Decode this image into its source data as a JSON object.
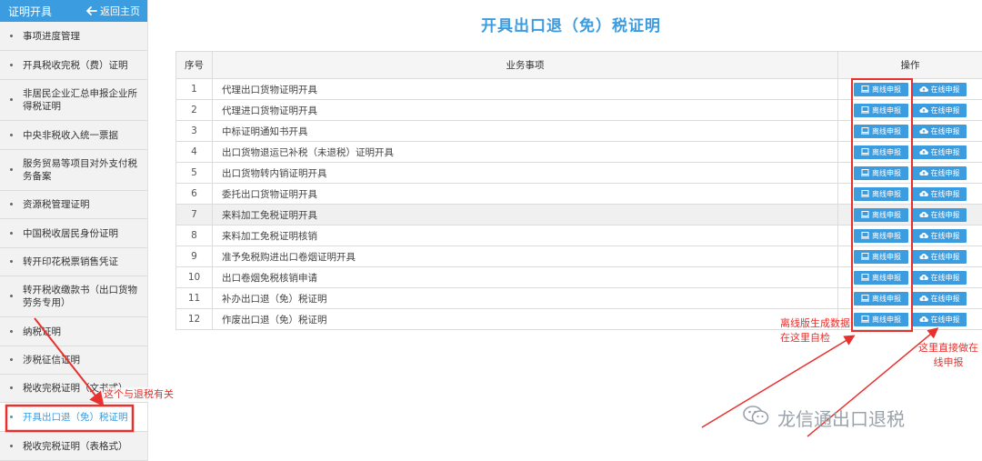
{
  "sidebar": {
    "title": "证明开具",
    "back_label": "返回主页",
    "items": [
      {
        "label": "事项进度管理"
      },
      {
        "label": "开具税收完税（费）证明"
      },
      {
        "label": "非居民企业汇总申报企业所得税证明"
      },
      {
        "label": "中央非税收入统一票据"
      },
      {
        "label": "服务贸易等项目对外支付税务备案"
      },
      {
        "label": "资源税管理证明"
      },
      {
        "label": "中国税收居民身份证明"
      },
      {
        "label": "转开印花税票销售凭证"
      },
      {
        "label": "转开税收缴款书（出口货物劳务专用）"
      },
      {
        "label": "纳税证明"
      },
      {
        "label": "涉税征信证明"
      },
      {
        "label": "税收完税证明（文书式）"
      },
      {
        "label": "开具出口退（免）税证明"
      },
      {
        "label": "税收完税证明（表格式）"
      }
    ]
  },
  "main": {
    "title": "开具出口退（免）税证明",
    "table": {
      "headers": [
        "序号",
        "业务事项",
        "操作"
      ],
      "offline_label": "离线申报",
      "online_label": "在线申报",
      "rows": [
        {
          "num": "1",
          "name": "代理出口货物证明开具"
        },
        {
          "num": "2",
          "name": "代理进口货物证明开具"
        },
        {
          "num": "3",
          "name": "中标证明通知书开具"
        },
        {
          "num": "4",
          "name": "出口货物退运已补税（未退税）证明开具"
        },
        {
          "num": "5",
          "name": "出口货物转内销证明开具"
        },
        {
          "num": "6",
          "name": "委托出口货物证明开具"
        },
        {
          "num": "7",
          "name": "来料加工免税证明开具"
        },
        {
          "num": "8",
          "name": "来料加工免税证明核销"
        },
        {
          "num": "9",
          "name": "准予免税购进出口卷烟证明开具"
        },
        {
          "num": "10",
          "name": "出口卷烟免税核销申请"
        },
        {
          "num": "11",
          "name": "补办出口退（免）税证明"
        },
        {
          "num": "12",
          "name": "作废出口退（免）税证明"
        }
      ]
    }
  },
  "annotations": {
    "offline_note": "离线版生成数据在这里自检",
    "online_note": "这里直接做在线申报",
    "sidebar_note": "这个与退税有关",
    "color": "#e8312e"
  },
  "watermark": {
    "text": "龙信通出口退税",
    "icon": "wechat-icon"
  },
  "colors": {
    "accent": "#3c9ce0",
    "annotation": "#e8312e"
  }
}
